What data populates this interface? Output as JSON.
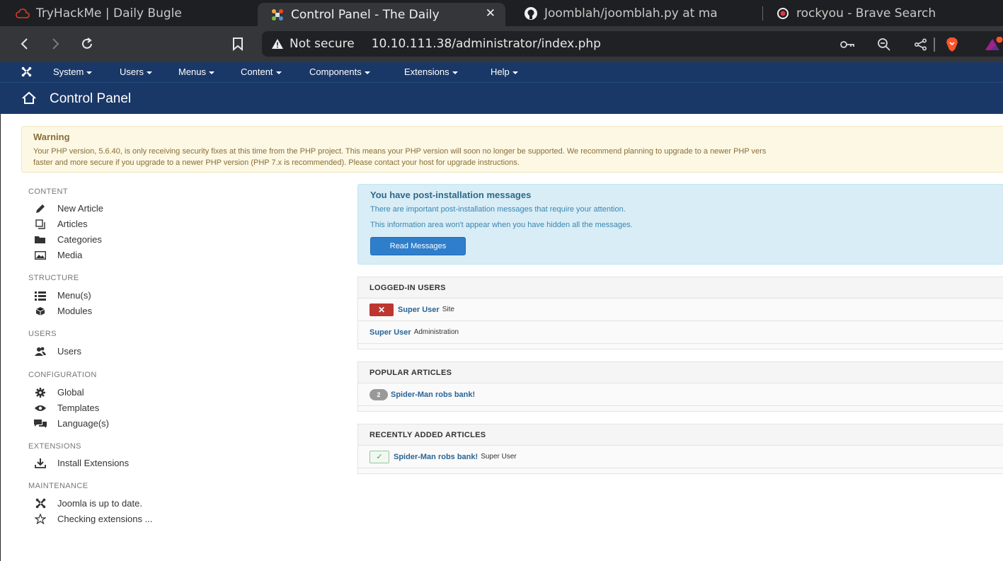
{
  "browser": {
    "tabs": [
      {
        "title": "TryHackMe | Daily Bugle",
        "icon": "tryhackme-cloud-icon",
        "active": false
      },
      {
        "title": "Control Panel - The Daily",
        "icon": "joomla-icon",
        "active": true
      },
      {
        "title": "Joomblah/joomblah.py at ma",
        "icon": "github-icon",
        "active": false
      },
      {
        "title": "rockyou - Brave Search",
        "icon": "brave-search-icon",
        "active": false
      }
    ],
    "security_label": "Not secure",
    "url": "10.10.111.38/administrator/index.php"
  },
  "joomla_menu": {
    "items": [
      "System",
      "Users",
      "Menus",
      "Content",
      "Components",
      "Extensions",
      "Help"
    ]
  },
  "page_title": "Control Panel",
  "warning": {
    "title": "Warning",
    "line1": "Your PHP version, 5.6.40, is only receiving security fixes at this time from the PHP project. This means your PHP version will soon no longer be supported. We recommend planning to upgrade to a newer PHP vers",
    "line2": "faster and more secure if you upgrade to a newer PHP version (PHP 7.x is recommended). Please contact your host for upgrade instructions."
  },
  "sidebar": {
    "sections": [
      {
        "heading": "CONTENT",
        "items": [
          {
            "label": "New Article",
            "icon": "pencil-icon"
          },
          {
            "label": "Articles",
            "icon": "stack-icon"
          },
          {
            "label": "Categories",
            "icon": "folder-icon"
          },
          {
            "label": "Media",
            "icon": "picture-icon"
          }
        ]
      },
      {
        "heading": "STRUCTURE",
        "items": [
          {
            "label": "Menu(s)",
            "icon": "list-icon"
          },
          {
            "label": "Modules",
            "icon": "cube-icon"
          }
        ]
      },
      {
        "heading": "USERS",
        "items": [
          {
            "label": "Users",
            "icon": "users-icon"
          }
        ]
      },
      {
        "heading": "CONFIGURATION",
        "items": [
          {
            "label": "Global",
            "icon": "cog-icon"
          },
          {
            "label": "Templates",
            "icon": "eye-icon"
          },
          {
            "label": "Language(s)",
            "icon": "comments-icon"
          }
        ]
      },
      {
        "heading": "EXTENSIONS",
        "items": [
          {
            "label": "Install Extensions",
            "icon": "download-icon"
          }
        ]
      },
      {
        "heading": "MAINTENANCE",
        "items": [
          {
            "label": "Joomla is up to date.",
            "icon": "joomla-icon"
          },
          {
            "label": "Checking extensions ...",
            "icon": "star-icon"
          }
        ]
      }
    ]
  },
  "post_install": {
    "title": "You have post-installation messages",
    "text1": "There are important post-installation messages that require your attention.",
    "text2": "This information area won't appear when you have hidden all the messages.",
    "button": "Read Messages"
  },
  "logged_in": {
    "heading": "LOGGED-IN USERS",
    "rows": [
      {
        "user": "Super User",
        "context": "Site",
        "logout_icon": "x-icon"
      },
      {
        "user": "Super User",
        "context": "Administration"
      }
    ]
  },
  "popular": {
    "heading": "POPULAR ARTICLES",
    "rows": [
      {
        "hits": "2",
        "title": "Spider-Man robs bank!"
      }
    ]
  },
  "recent": {
    "heading": "RECENTLY ADDED ARTICLES",
    "rows": [
      {
        "title": "Spider-Man robs bank!",
        "author": "Super User",
        "status_icon": "check-icon"
      }
    ]
  },
  "colors": {
    "menu_bg": "#1a3867",
    "warning_bg": "#fcf8e3",
    "info_bg": "#d9edf7",
    "button_blue": "#2f7ecb",
    "danger_red": "#bd362f",
    "link": "#2a6496"
  }
}
